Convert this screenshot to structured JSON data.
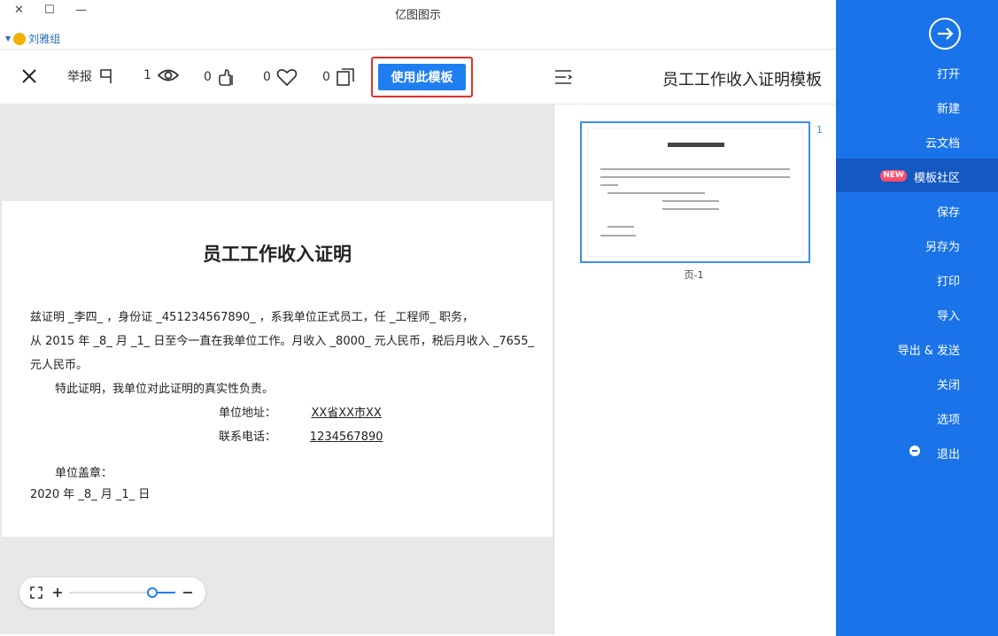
{
  "window": {
    "title": "亿图图示",
    "controls": [
      "✕",
      "☐",
      "—"
    ]
  },
  "user": {
    "name": "刘雅组"
  },
  "toolbar": {
    "close": "✕",
    "report_label": "举报",
    "views": "1",
    "likes": "0",
    "favorites": "0",
    "copies": "0",
    "use_template": "使用此模板",
    "template_title": "员工工作收入证明模板"
  },
  "document": {
    "title": "员工工作收入证明",
    "line1": "兹证明 _李四_ ，身份证 _451234567890_ ，系我单位正式员工，任 _工程师_ 职务，",
    "line2": "从 2015 年 _8_ 月 _1_ 日至今一直在我单位工作。月收入 _8000_ 元人民币，税后月收入 _7655_",
    "line3": "元人民币。",
    "line4": "特此证明，我单位对此证明的真实性负责。",
    "address_label": "单位地址：",
    "address_value": "XX省XX市XX",
    "phone_label": "联系电话：",
    "phone_value": "1234567890",
    "seal_label": "单位盖章：",
    "date": "2020 年 _8_ 月 _1_ 日"
  },
  "thumbnail": {
    "number": "1",
    "label": "页-1"
  },
  "sidebar": {
    "items": [
      {
        "label": "打开"
      },
      {
        "label": "新建"
      },
      {
        "label": "云文档"
      },
      {
        "label": "模板社区",
        "badge": "NEW"
      },
      {
        "label": "保存"
      },
      {
        "label": "另存为"
      },
      {
        "label": "打印"
      },
      {
        "label": "导入"
      },
      {
        "label": "导出 & 发送"
      },
      {
        "label": "关闭"
      },
      {
        "label": "选项"
      },
      {
        "label": "退出"
      }
    ]
  },
  "colors": {
    "sidebar": "#1a73e8",
    "sidebar_active": "#1458c2",
    "primary_button": "#1f7ff0",
    "highlight_border": "#e0302a",
    "new_badge": "#ff4d6a"
  },
  "icons": [
    "back-arrow-icon",
    "close-icon",
    "report-flag-icon",
    "eye-icon",
    "thumb-up-icon",
    "heart-icon",
    "copy-icon",
    "menu-list-icon",
    "fit-screen-icon",
    "zoom-in-icon",
    "zoom-out-icon",
    "exit-icon"
  ]
}
